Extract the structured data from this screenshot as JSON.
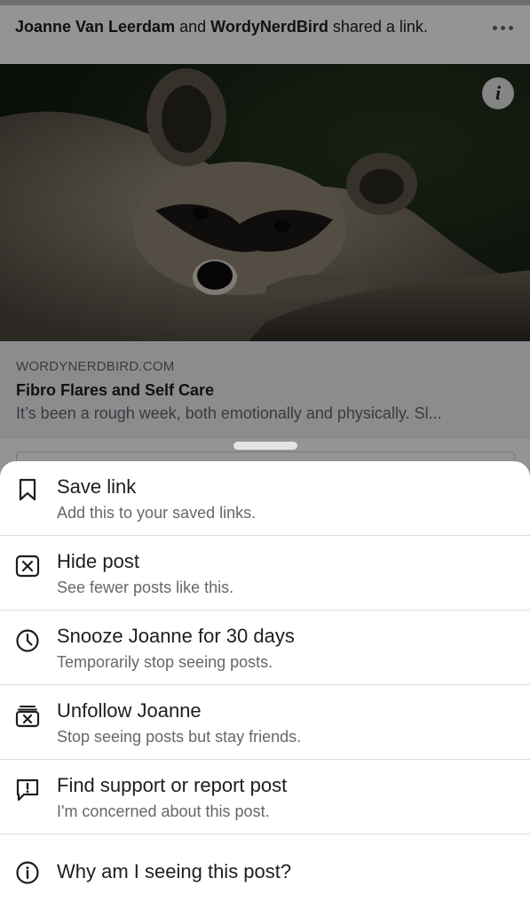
{
  "post": {
    "author_1": "Joanne Van Leerdam",
    "connector": "and",
    "author_2": "WordyNerdBird",
    "action": "shared a link.",
    "more_icon": "more-horizontal-icon",
    "info_icon": "info-icon"
  },
  "link_preview": {
    "domain": "WORDYNERDBIRD.COM",
    "title": "Fibro Flares and Self Care",
    "description": "It’s been a rough week, both emotionally and physically. Sl..."
  },
  "menu": {
    "items": [
      {
        "icon": "bookmark-icon",
        "title": "Save link",
        "subtitle": "Add this to your saved links."
      },
      {
        "icon": "hide-post-icon",
        "title": "Hide post",
        "subtitle": "See fewer posts like this."
      },
      {
        "icon": "clock-icon",
        "title": "Snooze Joanne for 30 days",
        "subtitle": "Temporarily stop seeing posts."
      },
      {
        "icon": "unfollow-icon",
        "title": "Unfollow Joanne",
        "subtitle": "Stop seeing posts but stay friends."
      },
      {
        "icon": "report-icon",
        "title": "Find support or report post",
        "subtitle": "I'm concerned about this post."
      },
      {
        "icon": "info-circle-icon",
        "title": "Why am I seeing this post?"
      }
    ]
  }
}
